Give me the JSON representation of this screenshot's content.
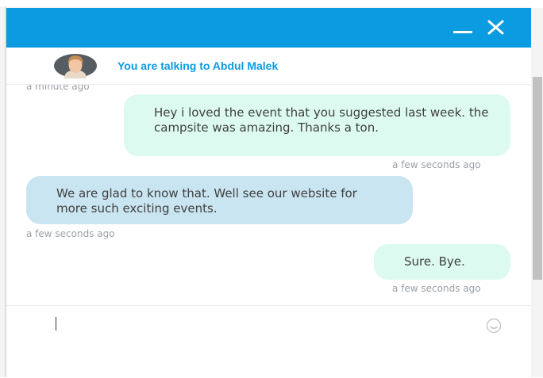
{
  "header": {
    "minimize_icon": "minimize-icon",
    "close_icon": "close-icon",
    "color": "#0a9be0"
  },
  "agent_bar": {
    "title": "You are talking to Abdul Malek",
    "avatar_icon": "avatar"
  },
  "messages": [
    {
      "from": "agent",
      "text": "",
      "time": "a minute ago"
    },
    {
      "from": "user",
      "text": "Hey i loved the event that you suggested last week. the campsite was amazing. Thanks a ton.",
      "time": "a few seconds ago"
    },
    {
      "from": "agent",
      "text": "We are glad to know that. Well see our website for more such exciting events.",
      "time": "a few seconds ago"
    },
    {
      "from": "user",
      "text": "Sure. Bye.",
      "time": "a few seconds ago"
    }
  ],
  "composer": {
    "value": "",
    "emoji_icon": "smiley-icon"
  },
  "colors": {
    "user_bubble": "#dcfaf0",
    "agent_bubble": "#c9e5f1",
    "timestamp": "#9aa0a6"
  }
}
